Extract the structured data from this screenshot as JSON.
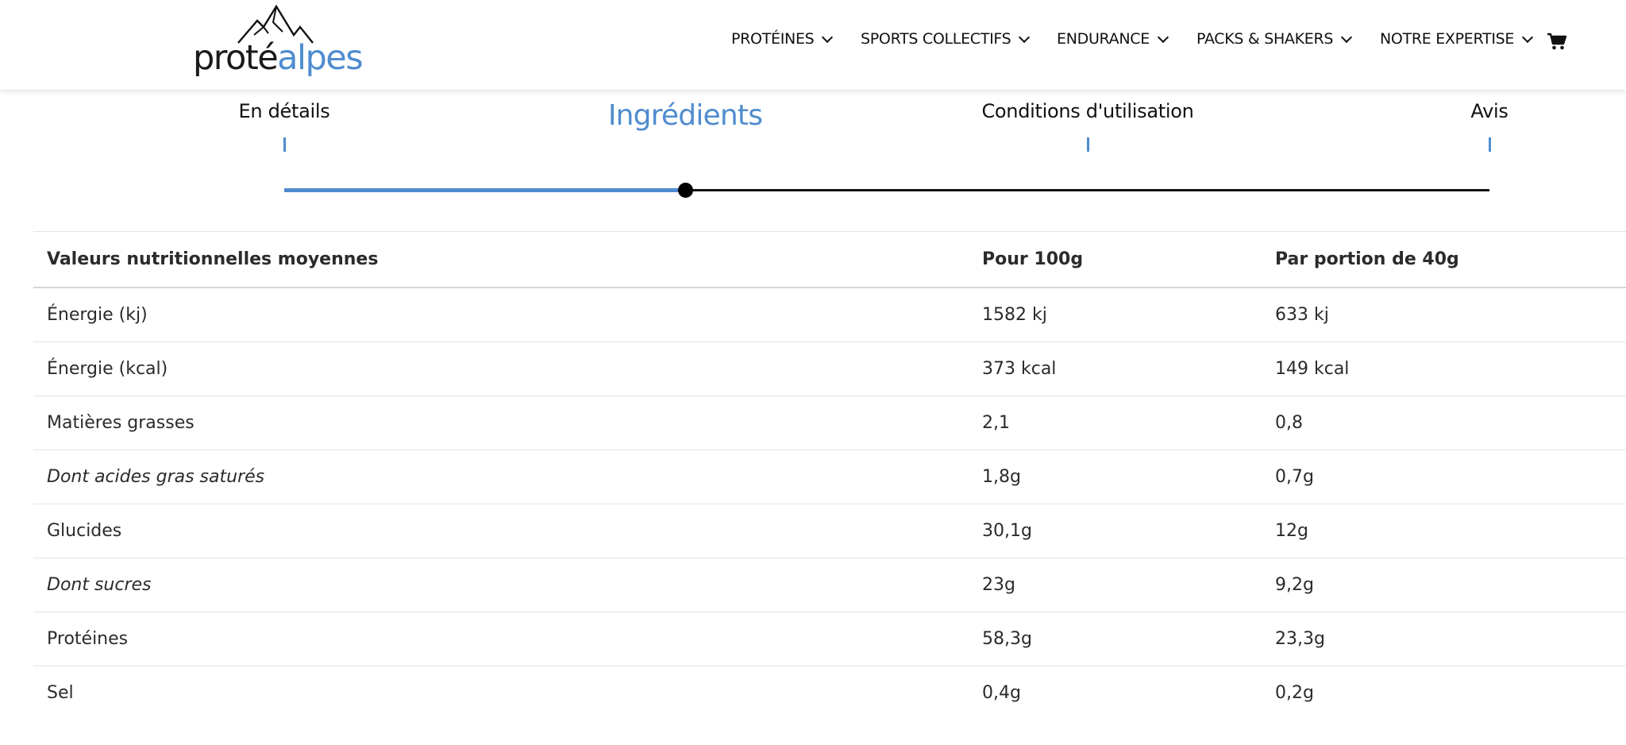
{
  "brand": {
    "logo_dark": "proté",
    "logo_blue": "alpes",
    "colors": {
      "accent": "#4f8ccf",
      "text": "#111111"
    }
  },
  "nav": {
    "items": [
      {
        "label": "PROTÉINES"
      },
      {
        "label": "SPORTS COLLECTIFS"
      },
      {
        "label": "ENDURANCE"
      },
      {
        "label": "PACKS & SHAKERS"
      },
      {
        "label": "NOTRE EXPERTISE"
      }
    ],
    "cart_icon": "cart-icon",
    "chevron_icon": "chevron-down-icon"
  },
  "tabs": {
    "items": [
      {
        "label": "En détails",
        "active": false
      },
      {
        "label": "Ingrédients",
        "active": true
      },
      {
        "label": "Conditions d'utilisation",
        "active": false
      },
      {
        "label": "Avis",
        "active": false
      }
    ],
    "progress": 0.333
  },
  "nutrition": {
    "headers": [
      "Valeurs nutritionnelles moyennes",
      "Pour 100g",
      "Par portion de 40g"
    ],
    "rows": [
      {
        "name": "Énergie (kj)",
        "per100": "1582 kj",
        "portion": "633 kj",
        "italic": false
      },
      {
        "name": "Énergie (kcal)",
        "per100": "373 kcal",
        "portion": "149 kcal",
        "italic": false
      },
      {
        "name": "Matières grasses",
        "per100": "2,1",
        "portion": "0,8",
        "italic": false
      },
      {
        "name": "Dont acides gras saturés",
        "per100": "1,8g",
        "portion": "0,7g",
        "italic": true
      },
      {
        "name": "Glucides",
        "per100": "30,1g",
        "portion": "12g",
        "italic": false
      },
      {
        "name": "Dont sucres",
        "per100": "23g",
        "portion": "9,2g",
        "italic": true
      },
      {
        "name": "Protéines",
        "per100": "58,3g",
        "portion": "23,3g",
        "italic": false
      },
      {
        "name": "Sel",
        "per100": "0,4g",
        "portion": "0,2g",
        "italic": false
      }
    ]
  }
}
